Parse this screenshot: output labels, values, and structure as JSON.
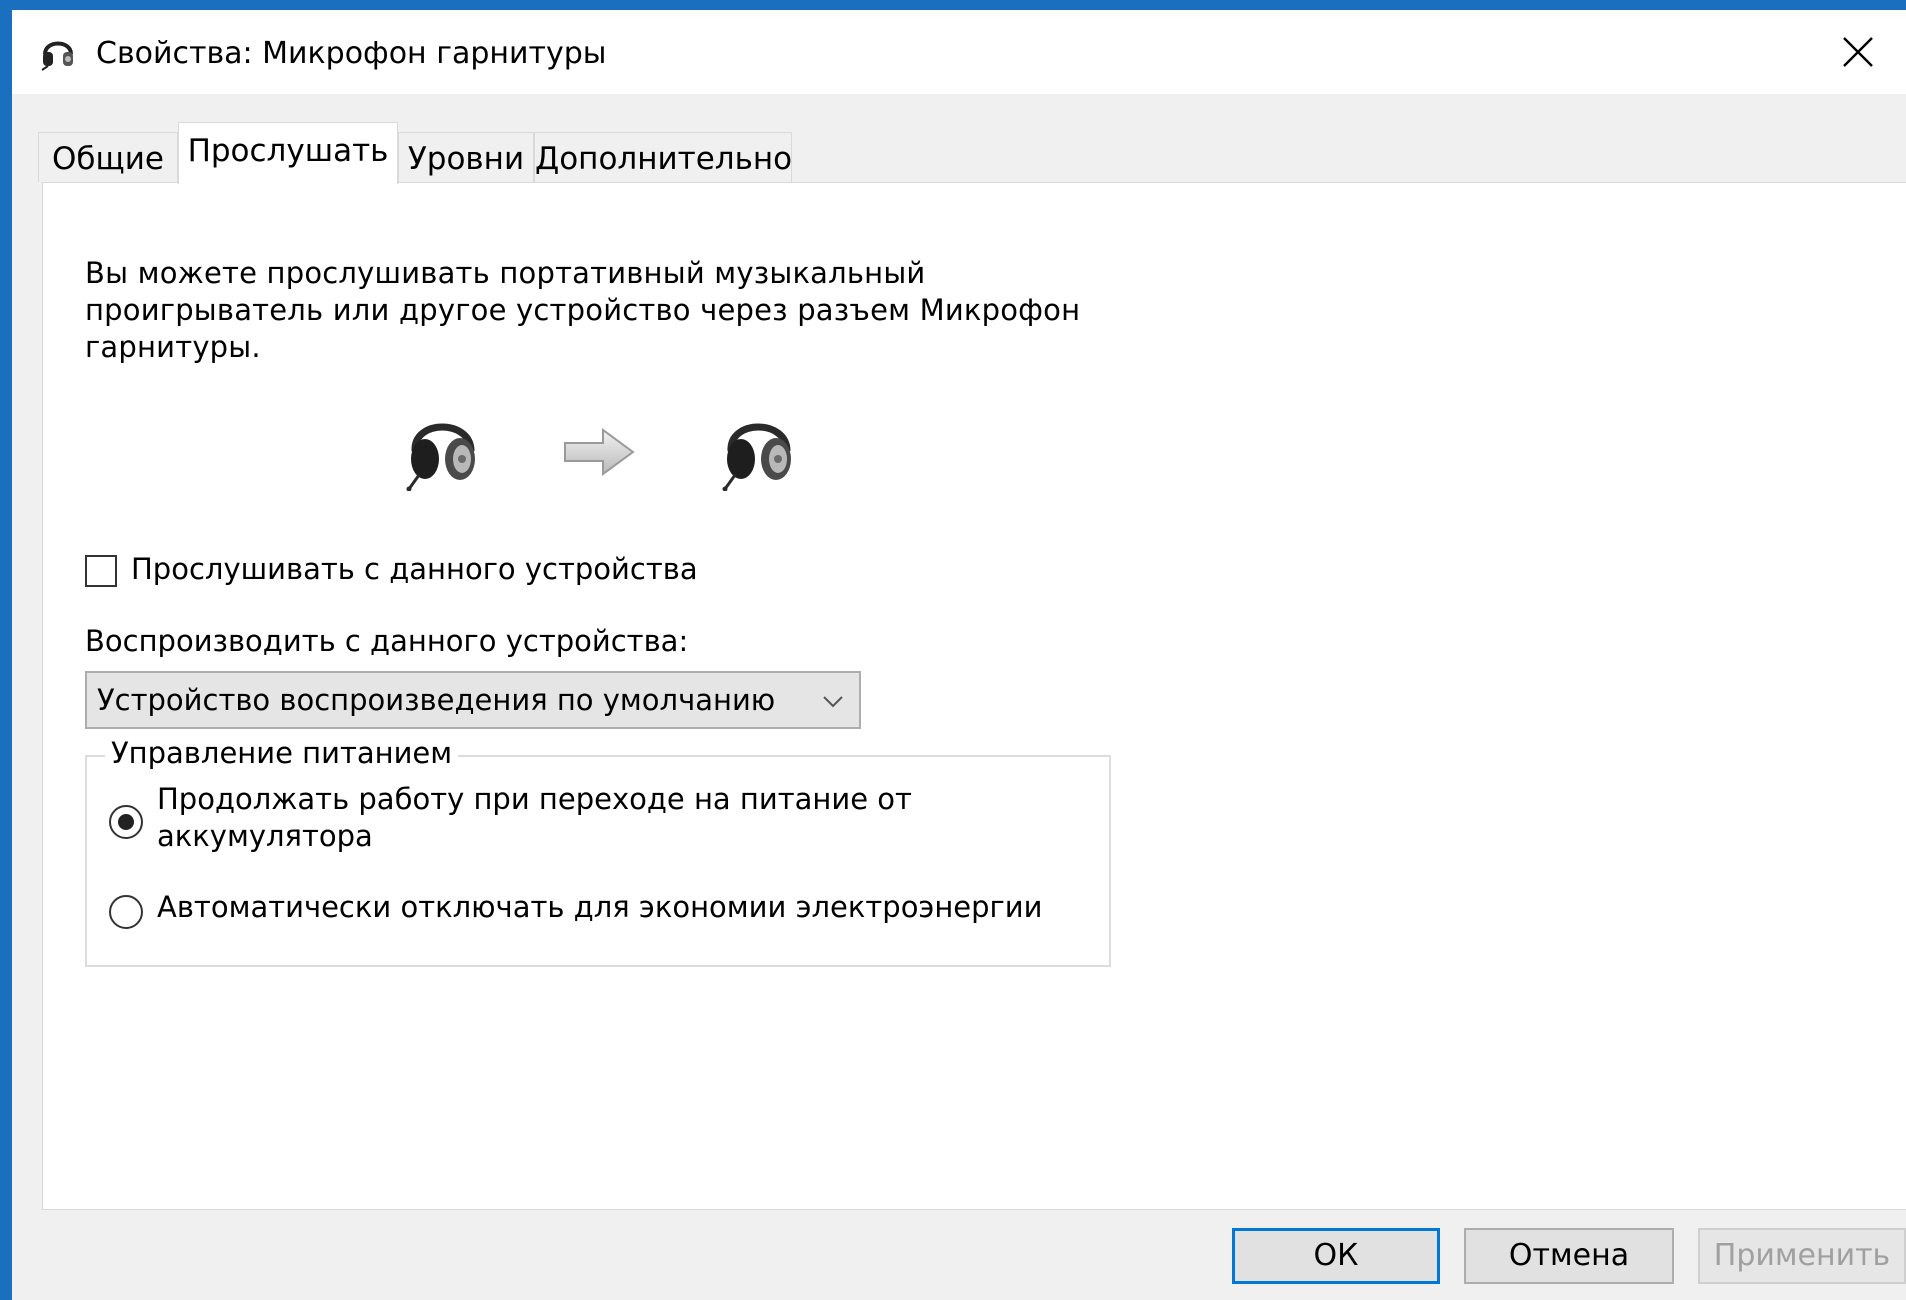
{
  "window": {
    "title": "Свойства: Микрофон гарнитуры",
    "title_icon": "headset-icon",
    "close_icon": "close-icon"
  },
  "tabs": [
    {
      "label": "Общие",
      "active": false
    },
    {
      "label": "Прослушать",
      "active": true
    },
    {
      "label": "Уровни",
      "active": false
    },
    {
      "label": "Дополнительно",
      "active": false
    }
  ],
  "listen": {
    "description": "Вы можете прослушивать портативный музыкальный проигрыватель или другое устройство через разъем Микрофон гарнитуры.",
    "diagram_icons": [
      "headset-icon",
      "arrow-right-icon",
      "headset-icon"
    ],
    "checkbox_label": "Прослушивать с данного устройства",
    "checkbox_checked": false,
    "playback_label": "Воспроизводить с данного устройства:",
    "playback_selected": "Устройство воспроизведения по умолчанию"
  },
  "power": {
    "legend": "Управление питанием",
    "options": [
      {
        "label": "Продолжать работу при переходе на питание от аккумулятора",
        "selected": true
      },
      {
        "label": "Автоматически отключать для экономии электроэнергии",
        "selected": false
      }
    ]
  },
  "buttons": {
    "ok": "ОК",
    "cancel": "Отмена",
    "apply": "Применить",
    "apply_enabled": false
  },
  "colors": {
    "frame": "#1a6fbf",
    "focus_border": "#0078d7"
  }
}
